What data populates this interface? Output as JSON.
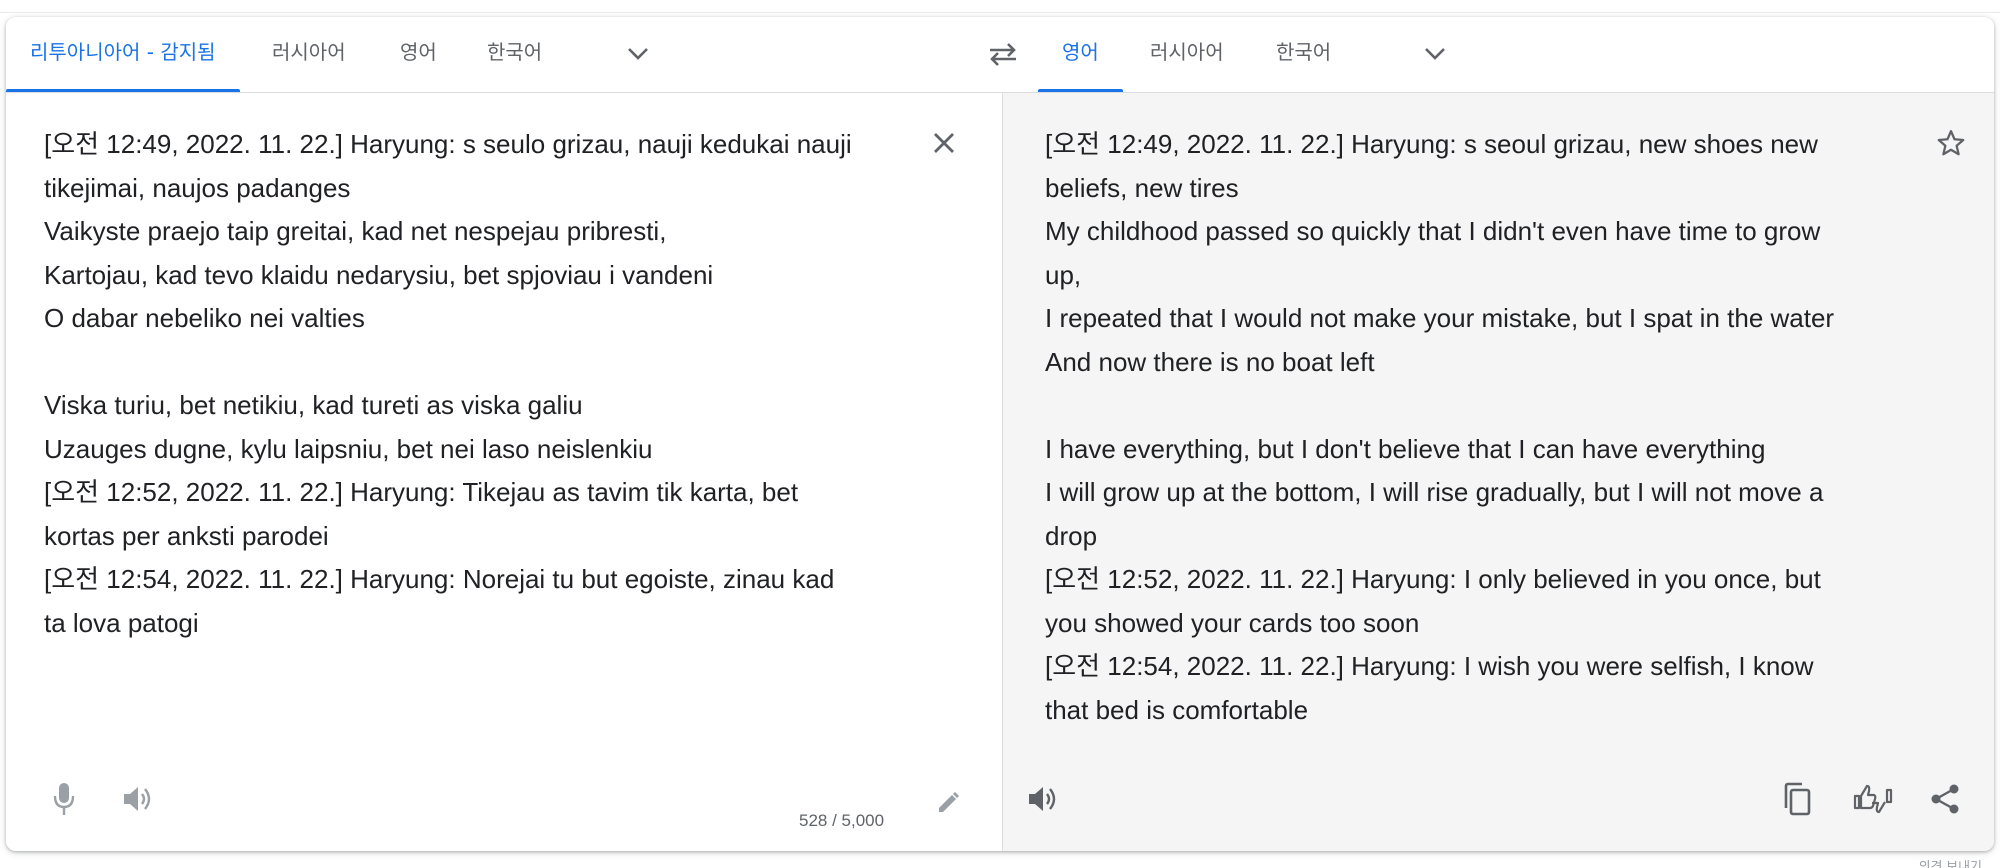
{
  "source_tabs": [
    {
      "label": "리투아니아어 - 감지됨",
      "active": true
    },
    {
      "label": "러시아어",
      "active": false
    },
    {
      "label": "영어",
      "active": false
    },
    {
      "label": "한국어",
      "active": false
    }
  ],
  "target_tabs": [
    {
      "label": "영어",
      "active": true
    },
    {
      "label": "러시아어",
      "active": false
    },
    {
      "label": "한국어",
      "active": false
    }
  ],
  "source_text": "[오전 12:49, 2022. 11. 22.] Haryung: s seulo grizau, nauji kedukai nauji\ntikejimai, naujos padanges\nVaikyste praejo taip greitai, kad net nespejau pribresti,\nKartojau, kad tevo klaidu nedarysiu, bet spjoviau i vandeni\nO dabar nebeliko nei valties\n\nViska turiu, bet netikiu, kad tureti as viska galiu\nUzauges dugne, kylu laipsniu, bet nei laso neislenkiu\n[오전 12:52, 2022. 11. 22.] Haryung: Tikejau as tavim tik karta, bet\nkortas per anksti parodei\n[오전 12:54, 2022. 11. 22.] Haryung: Norejai tu but egoiste, zinau kad\nta lova patogi",
  "translated_text": "[오전 12:49, 2022. 11. 22.] Haryung: s seoul grizau, new shoes new\nbeliefs, new tires\nMy childhood passed so quickly that I didn't even have time to grow\nup,\nI repeated that I would not make your mistake, but I spat in the water\nAnd now there is no boat left\n\nI have everything, but I don't believe that I can have everything\nI will grow up at the bottom, I will rise gradually, but I will not move a\ndrop\n[오전 12:52, 2022. 11. 22.] Haryung: I only believed in you once, but\nyou showed your cards too soon\n[오전 12:54, 2022. 11. 22.] Haryung: I wish you were selfish, I know\nthat bed is comfortable",
  "char_count": "528 / 5,000",
  "footer_note": "의견 보내기",
  "colors": {
    "accent": "#1a73e8",
    "icon": "#5f6368",
    "icon_disabled": "#9aa0a6",
    "target_bg": "#f5f5f5"
  },
  "icons": {
    "more_source": "chevron-down-icon",
    "swap": "swap-icon",
    "more_target": "chevron-down-icon",
    "clear": "close-icon",
    "star": "star-icon",
    "mic": "mic-icon",
    "listen_source": "speaker-icon",
    "edit": "pencil-icon",
    "listen_target": "speaker-icon",
    "copy": "copy-icon",
    "rate": "thumbs-icon",
    "share": "share-icon"
  }
}
